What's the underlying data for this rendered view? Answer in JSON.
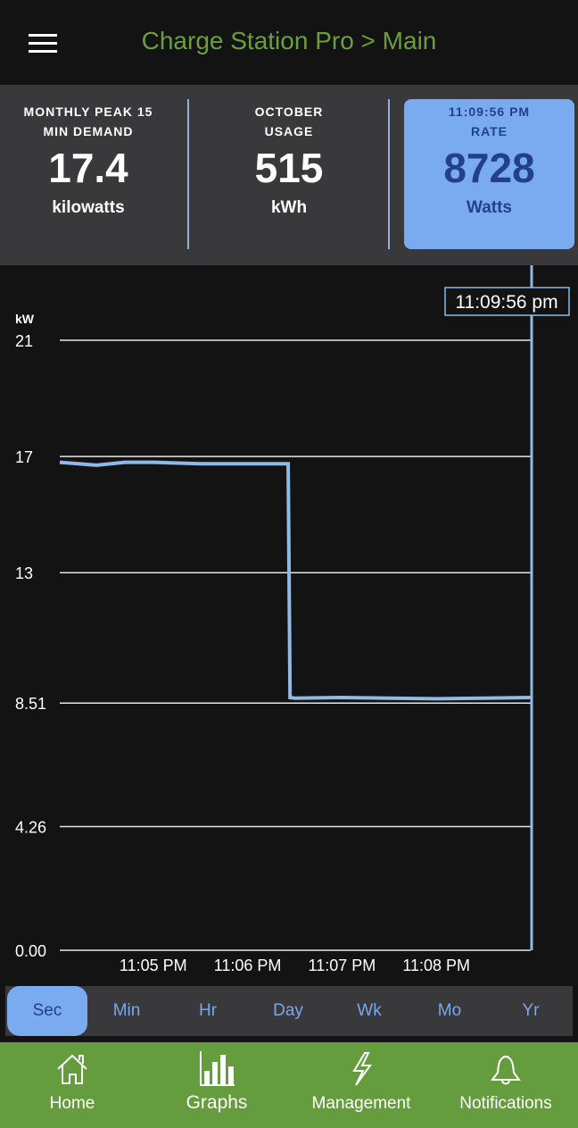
{
  "header": {
    "title": "Charge Station Pro > Main"
  },
  "stats": [
    {
      "label1": "MONTHLY PEAK 15",
      "label2": "MIN DEMAND",
      "value": "17.4",
      "unit": "kilowatts"
    },
    {
      "label1": "OCTOBER",
      "label2": "USAGE",
      "value": "515",
      "unit": "kWh"
    },
    {
      "label1": "11:09:56 PM",
      "label2": "RATE",
      "value": "8728",
      "unit": "Watts"
    }
  ],
  "chart_data": {
    "type": "line",
    "ylabel": "kW",
    "ylim": [
      0,
      21
    ],
    "yticks": [
      "21",
      "17",
      "13",
      "8.51",
      "4.26",
      "0.00"
    ],
    "ytick_values": [
      21,
      17,
      13,
      8.51,
      4.26,
      0
    ],
    "xticks": [
      "11:05 PM",
      "11:06 PM",
      "11:07 PM",
      "11:08 PM"
    ],
    "xlim_minutes": [
      -0.99,
      4.0
    ],
    "cursor_label": "11:09:56 pm",
    "color": "#8fb9e6",
    "series": [
      {
        "x": [
          -0.99,
          -0.6,
          -0.3,
          0,
          0.5,
          1,
          1.3,
          1.43,
          1.45,
          1.5,
          2,
          2.5,
          3,
          3.5,
          4.0
        ],
        "y": [
          16.8,
          16.7,
          16.8,
          16.8,
          16.75,
          16.75,
          16.75,
          16.75,
          8.7,
          8.68,
          8.7,
          8.68,
          8.66,
          8.68,
          8.7
        ]
      }
    ]
  },
  "tabs": [
    "Sec",
    "Min",
    "Hr",
    "Day",
    "Wk",
    "Mo",
    "Yr"
  ],
  "nav": [
    "Home",
    "Graphs",
    "Management",
    "Notifications"
  ]
}
